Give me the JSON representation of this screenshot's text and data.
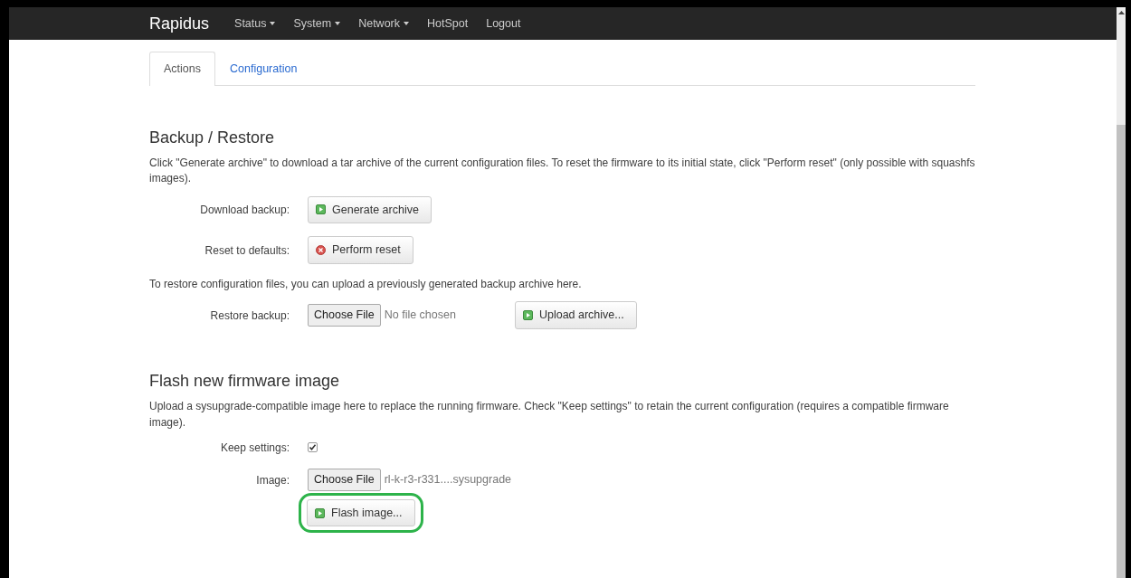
{
  "navbar": {
    "brand": "Rapidus",
    "items": [
      {
        "label": "Status",
        "dropdown": true
      },
      {
        "label": "System",
        "dropdown": true
      },
      {
        "label": "Network",
        "dropdown": true
      },
      {
        "label": "HotSpot",
        "dropdown": false
      },
      {
        "label": "Logout",
        "dropdown": false
      }
    ]
  },
  "tabs": [
    {
      "label": "Actions",
      "selected": true
    },
    {
      "label": "Configuration",
      "selected": false
    }
  ],
  "sections": [
    {
      "title": "Backup / Restore",
      "blocks": [
        {
          "kind": "text",
          "text": "Click \"Generate archive\" to download a tar archive of the current configuration files. To reset the firmware to its initial state, click \"Perform reset\" (only possible with squashfs images)."
        },
        {
          "kind": "row",
          "label": "Download backup:",
          "controls": [
            {
              "kind": "apply",
              "label": "Generate archive",
              "highlighted": false
            }
          ]
        },
        {
          "kind": "row",
          "label": "Reset to defaults:",
          "controls": [
            {
              "kind": "reset",
              "label": "Perform reset",
              "highlighted": false
            }
          ]
        },
        {
          "kind": "text",
          "text": "To restore configuration files, you can upload a previously generated backup archive here."
        },
        {
          "kind": "row",
          "label": "Restore backup:",
          "controls": [
            {
              "kind": "file",
              "button": "Choose File",
              "filename": "No file chosen"
            },
            {
              "kind": "apply",
              "label": "Upload archive...",
              "highlighted": false
            }
          ]
        }
      ]
    },
    {
      "title": "Flash new firmware image",
      "blocks": [
        {
          "kind": "text",
          "text": "Upload a sysupgrade-compatible image here to replace the running firmware. Check \"Keep settings\" to retain the current configuration (requires a compatible firmware image)."
        },
        {
          "kind": "row",
          "label": "Keep settings:",
          "controls": [
            {
              "kind": "checkbox",
              "checked": true
            }
          ]
        },
        {
          "kind": "row",
          "label": "Image:",
          "controls": [
            {
              "kind": "file",
              "button": "Choose File",
              "filename": "rl-k-r3-r331....sysupgrade"
            }
          ],
          "below": [
            {
              "kind": "apply",
              "label": "Flash image...",
              "highlighted": true
            }
          ]
        }
      ]
    }
  ]
}
